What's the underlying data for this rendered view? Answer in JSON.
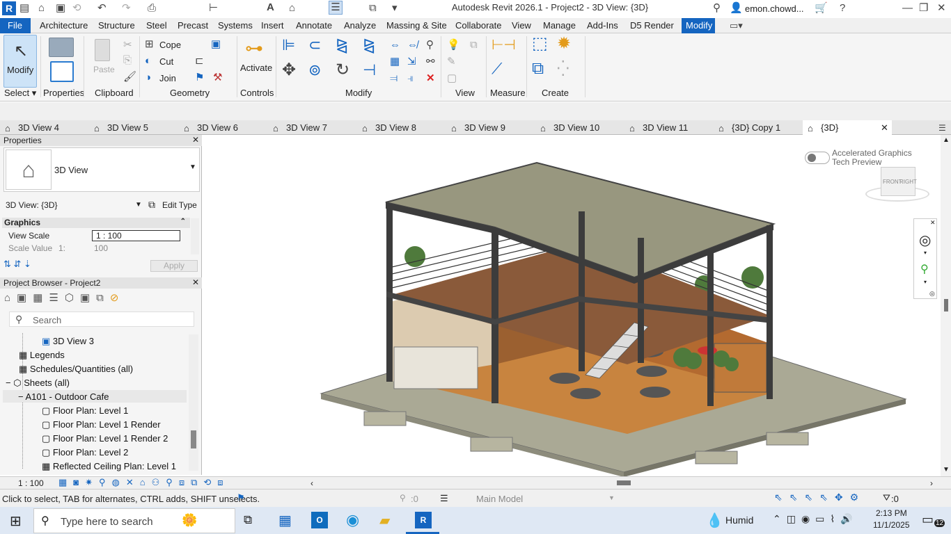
{
  "title_bar": {
    "title": "Autodesk Revit 2026.1 - Project2 - 3D View: {3D}",
    "user": "emon.chowd..."
  },
  "menu": {
    "file": "File",
    "tabs": [
      "Architecture",
      "Structure",
      "Steel",
      "Precast",
      "Systems",
      "Insert",
      "Annotate",
      "Analyze",
      "Massing & Site",
      "Collaborate",
      "View",
      "Manage",
      "Add-Ins",
      "D5 Render",
      "Modify"
    ]
  },
  "ribbon": {
    "modify_label": "Modify",
    "select": "Select",
    "properties": "Properties",
    "paste": "Paste",
    "clipboard": "Clipboard",
    "cope": "Cope",
    "cut": "Cut",
    "join": "Join",
    "geometry": "Geometry",
    "activate": "Activate",
    "controls": "Controls",
    "modify": "Modify",
    "view": "View",
    "measure": "Measure",
    "create": "Create"
  },
  "view_tabs": [
    "3D View 4",
    "3D View 5",
    "3D View 6",
    "3D View 7",
    "3D View 8",
    "3D View 9",
    "3D View 10",
    "3D View 11",
    "{3D} Copy 1",
    "{3D}"
  ],
  "properties": {
    "title": "Properties",
    "type_name": "3D View",
    "instance": "3D View: {3D}",
    "edit_type": "Edit Type",
    "section": "Graphics",
    "rows": [
      {
        "name": "View Scale",
        "value": "1 : 100"
      },
      {
        "name": "Scale Value",
        "value_prefix": "1:",
        "value": "100"
      }
    ],
    "apply": "Apply"
  },
  "project_browser": {
    "title": "Project Browser - Project2",
    "search_placeholder": "Search",
    "items": [
      "3D View 3",
      "Legends",
      "Schedules/Quantities (all)",
      "Sheets (all)",
      "A101 - Outdoor Cafe",
      "Floor Plan: Level 1",
      "Floor Plan: Level 1 Render",
      "Floor Plan: Level 1 Render 2",
      "Floor Plan: Level 2",
      "Reflected Ceiling Plan: Level 1"
    ]
  },
  "canvas": {
    "accelerated": "Accelerated Graphics",
    "tech_preview": "Tech Preview",
    "cube_front": "FRONT",
    "cube_right": "RIGHT"
  },
  "view_control_bar": {
    "scale": "1 : 100"
  },
  "status": {
    "hint": "Click to select, TAB for alternates, CTRL adds, SHIFT unselects.",
    "zero1": ":0",
    "model": "Main Model",
    "filter": ":0"
  },
  "taskbar": {
    "search": "Type here to search",
    "weather": "Humid",
    "time": "2:13 PM",
    "date": "11/1/2025",
    "notifications": "12"
  },
  "colors": {
    "accent": "#1565c0",
    "floor": "#c8843f",
    "deck": "#9c9a85",
    "steel": "#3c3c3c"
  }
}
